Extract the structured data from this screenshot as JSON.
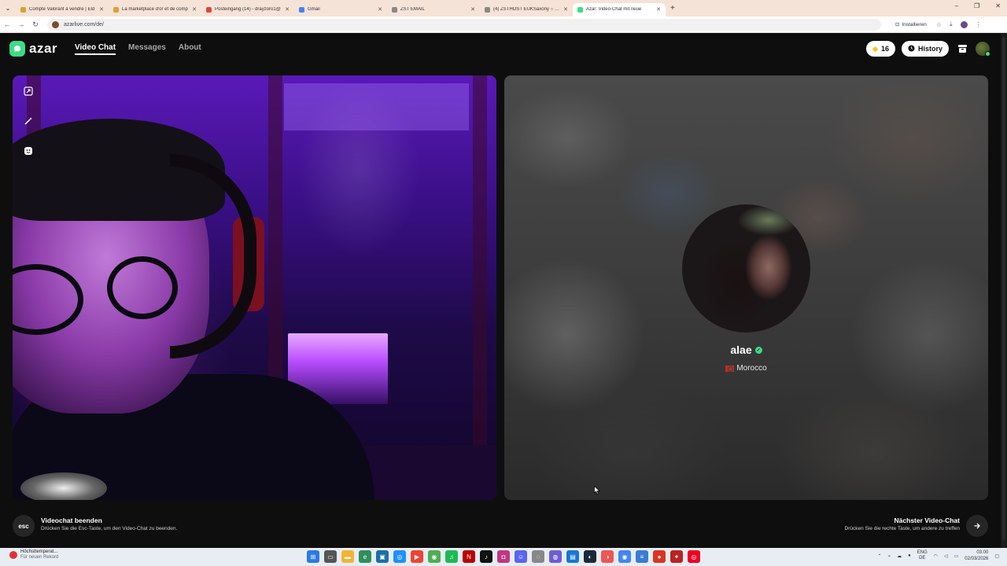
{
  "browser": {
    "tabs": [
      {
        "title": "Compte Valorant à vendre | Eld",
        "color": "#e0a030",
        "active": false
      },
      {
        "title": "La marketplace d'or et de comp",
        "color": "#e0a030",
        "active": false
      },
      {
        "title": "Posteingang (14) - drayzoro1@",
        "color": "#d44",
        "active": false
      },
      {
        "title": "Gmail",
        "color": "#4285f4",
        "active": false
      },
      {
        "title": "ZST EMAIL",
        "color": "#888",
        "active": false
      },
      {
        "title": "(4) ZSTHOST EUKSaxony ○ Inbo",
        "color": "#888",
        "active": false
      },
      {
        "title": "Azar: Video-Chat mit neue",
        "color": "#3ddc84",
        "active": true
      }
    ],
    "url": "azarlive.com/de/",
    "install_label": "Installieren"
  },
  "app": {
    "logo_text": "azar",
    "nav": [
      {
        "label": "Video Chat",
        "active": true
      },
      {
        "label": "Messages",
        "active": false
      },
      {
        "label": "About",
        "active": false
      }
    ],
    "gems": "16",
    "history_label": "History"
  },
  "peer": {
    "name": "alae",
    "country": "Morocco"
  },
  "controls": {
    "esc_key": "esc",
    "end_title": "Videochat beenden",
    "end_subtitle": "Drücken Sie die Esc-Taste, um den Video-Chat zu beenden.",
    "next_title": "Nächster Video-Chat",
    "next_subtitle": "Drücken Sie die rechte Taste, um andere zu treffen"
  },
  "taskbar": {
    "weather_title": "Höchsttemperat...",
    "weather_sub": "Für neuen Rekord",
    "lang_top": "ENG",
    "lang_bottom": "DE",
    "time": "03:00",
    "date": "02/03/2026"
  },
  "colors": {
    "accent": "#3ddc84",
    "background": "#0e0e0e"
  }
}
